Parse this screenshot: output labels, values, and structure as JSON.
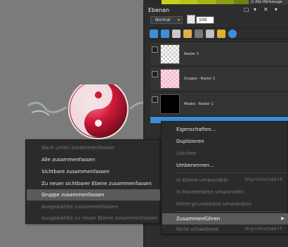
{
  "top_check_label": "Alle Werkzeuge",
  "palette": {
    "title": "Ebenen",
    "ctrl_icons": [
      "restore-icon",
      "expand-icon",
      "close-icon",
      "dropdown-icon"
    ],
    "ctrl_glyphs": [
      "□",
      "▾",
      "✕",
      "▾"
    ],
    "blend_mode": "Normal",
    "opacity": "100",
    "toolbar_icons": [
      "new-raster-layer-icon",
      "new-vector-layer-icon",
      "new-mask-icon",
      "duplicate-icon",
      "delete-icon",
      "link-icon",
      "lock-icon",
      "properties-icon"
    ],
    "layers": [
      {
        "name": "Raster 3"
      },
      {
        "name": "Gruppe - Raster 1"
      },
      {
        "name": "Maske - Raster 1"
      },
      {
        "name": ""
      }
    ]
  },
  "menu_left": {
    "items": [
      {
        "label": "Nach unten zusammenfassen",
        "state": "disabled"
      },
      {
        "label": "Alle zusammenfassen",
        "state": "normal"
      },
      {
        "label": "Sichtbare zusammenfassen",
        "state": "normal"
      },
      {
        "label": "Zu neuer sichtbarer Ebene zusammenfassen",
        "state": "normal"
      },
      {
        "label": "Gruppe zusammenfassen",
        "state": "active"
      },
      {
        "label": "Ausgewählte zusammenfassen",
        "state": "disabled"
      },
      {
        "label": "Ausgewählte zu neuer Ebene zusammenfassen",
        "state": "disabled"
      }
    ]
  },
  "menu_right": {
    "items": [
      {
        "label": "Eigenschaften...",
        "state": "normal",
        "shortcut": ""
      },
      {
        "label": "Duplizieren",
        "state": "normal",
        "shortcut": ""
      },
      {
        "label": "Löschen",
        "state": "disabled",
        "shortcut": ""
      },
      {
        "label": "Umbenennen...",
        "state": "normal",
        "shortcut": ""
      },
      {
        "label": "In Ebene umwandeln",
        "state": "disabled",
        "shortcut": "Strg+Umschalt+P"
      },
      {
        "label": "In Rasterebene umwandeln",
        "state": "disabled",
        "shortcut": ""
      },
      {
        "label": "Hintergrundebene umwandeln",
        "state": "disabled",
        "shortcut": ""
      },
      {
        "label": "Zusammenführen",
        "state": "active",
        "shortcut": "",
        "submenu": true
      },
      {
        "label": "Nicht schwebend",
        "state": "disabled",
        "shortcut": "Strg+Umschalt+F"
      }
    ]
  },
  "colors": {
    "menu_bg": "#2b2b2b",
    "active_item": "#5a5a5a",
    "selection_blue": "#3a8fd8",
    "accent_red": "#d01a3a"
  }
}
